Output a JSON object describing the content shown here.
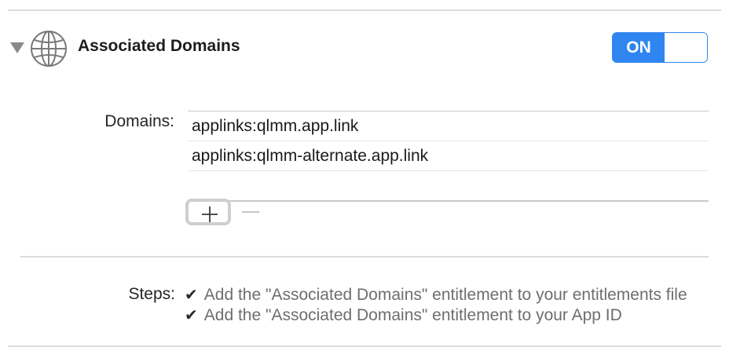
{
  "section": {
    "title": "Associated Domains",
    "icon": "globe-icon",
    "toggle": {
      "label": "ON",
      "state": "on",
      "accent": "#2f86f0"
    }
  },
  "domains": {
    "label": "Domains:",
    "items": [
      "applinks:qlmm.app.link",
      "applinks:qlmm-alternate.app.link"
    ],
    "add_icon": "plus-icon",
    "remove_icon": "minus-icon"
  },
  "steps": {
    "label": "Steps:",
    "items": [
      "Add the \"Associated Domains\" entitlement to your entitlements file",
      "Add the \"Associated Domains\" entitlement to your App ID"
    ],
    "check_icon": "checkmark-icon",
    "check_glyph": "✔"
  }
}
